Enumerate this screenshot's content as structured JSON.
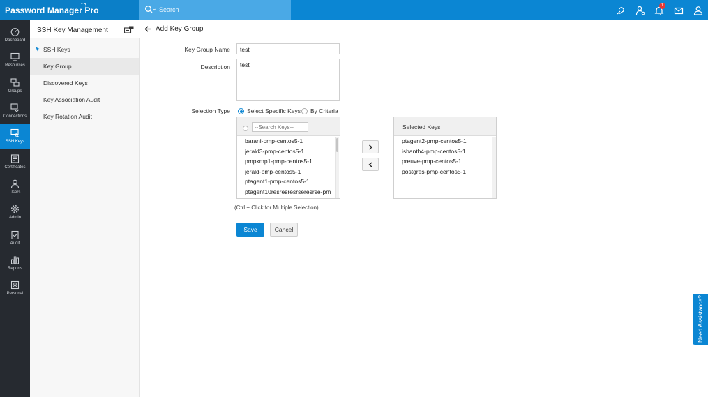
{
  "app": {
    "brand": "Password Manager Pro"
  },
  "search": {
    "placeholder": "Search"
  },
  "header_icons": [
    "link-icon",
    "user-settings-icon",
    "bell-icon",
    "mail-icon",
    "user-icon"
  ],
  "notifications": {
    "count": "1"
  },
  "colors": {
    "accent": "#0b86d3",
    "rail_bg": "#262a30",
    "badge": "#e53935"
  },
  "rail": [
    {
      "label": "Dashboard",
      "icon": "dashboard-icon"
    },
    {
      "label": "Resources",
      "icon": "monitor-icon"
    },
    {
      "label": "Groups",
      "icon": "groups-icon"
    },
    {
      "label": "Connections",
      "icon": "connections-icon"
    },
    {
      "label": "SSH Keys",
      "icon": "ssh-keys-icon",
      "active": true
    },
    {
      "label": "Certificates",
      "icon": "certificate-icon"
    },
    {
      "label": "Users",
      "icon": "users-icon"
    },
    {
      "label": "Admin",
      "icon": "gear-icon"
    },
    {
      "label": "Audit",
      "icon": "audit-icon"
    },
    {
      "label": "Reports",
      "icon": "reports-icon"
    },
    {
      "label": "Personal",
      "icon": "personal-icon"
    }
  ],
  "submenu": {
    "title": "SSH Key Management",
    "items": [
      {
        "label": "SSH Keys",
        "pinned": true
      },
      {
        "label": "Key Group",
        "selected": true
      },
      {
        "label": "Discovered Keys"
      },
      {
        "label": "Key Association Audit"
      },
      {
        "label": "Key Rotation Audit"
      }
    ]
  },
  "page": {
    "title": "Add Key Group"
  },
  "form": {
    "group_name_label": "Key Group Name",
    "group_name_value": "test",
    "description_label": "Description",
    "description_value": "test",
    "selection_type_label": "Selection Type",
    "option_specific": "Select Specific Keys",
    "option_criteria": "By Criteria",
    "key_search_placeholder": "--Search Keys--",
    "available_keys": [
      "barani-pmp-centos5-1",
      "jerald3-pmp-centos5-1",
      "pmpkmp1-pmp-centos5-1",
      "jerald-pmp-centos5-1",
      "ptagent1-pmp-centos5-1",
      "ptagent10resresresrseresrse-pm"
    ],
    "selected_keys_title": "Selected Keys",
    "selected_keys": [
      "ptagent2-pmp-centos5-1",
      "ishanth4-pmp-centos5-1",
      "preuve-pmp-centos5-1",
      "postgres-pmp-centos5-1"
    ],
    "hint": "(Ctrl + Click for Multiple Selection)",
    "save_label": "Save",
    "cancel_label": "Cancel"
  },
  "assistance": {
    "label": "Need Assistance?"
  }
}
